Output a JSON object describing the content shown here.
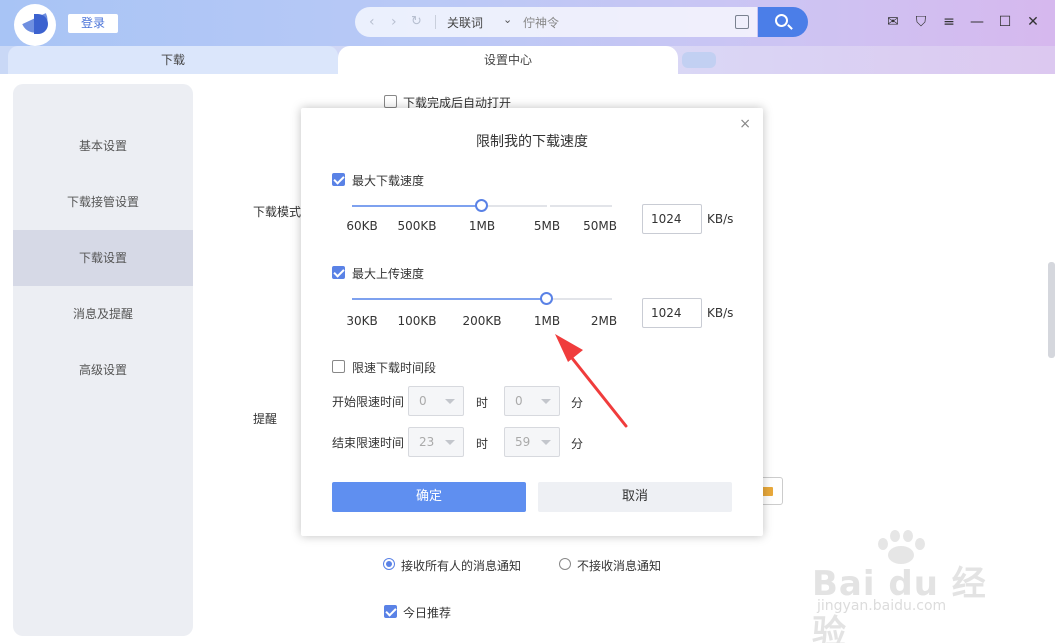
{
  "titlebar": {
    "login_label": "登录",
    "search_keyword": "关联词",
    "search_placeholder": "佇神令"
  },
  "tabs": [
    {
      "label": "下载"
    },
    {
      "label": "设置中心"
    }
  ],
  "sidebar": {
    "items": [
      {
        "label": "基本设置"
      },
      {
        "label": "下载接管设置"
      },
      {
        "label": "下载设置"
      },
      {
        "label": "消息及提醒"
      },
      {
        "label": "高级设置"
      }
    ]
  },
  "background": {
    "auto_open_label": "下载完成后自动打开",
    "download_mode_label": "下载模式",
    "reminder_label": "提醒",
    "receive_all_label": "接收所有人的消息通知",
    "no_receive_label": "不接收消息通知",
    "today_recommend_label": "今日推荐"
  },
  "modal": {
    "title": "限制我的下载速度",
    "close_symbol": "×",
    "max_download": {
      "label": "最大下载速度",
      "ticks": [
        "60KB",
        "500KB",
        "1MB",
        "5MB",
        "50MB"
      ],
      "value": "1024",
      "unit": "KB/s"
    },
    "max_upload": {
      "label": "最大上传速度",
      "ticks": [
        "30KB",
        "100KB",
        "200KB",
        "1MB",
        "2MB"
      ],
      "value": "1024",
      "unit": "KB/s"
    },
    "time_limit_label": "限速下载时间段",
    "start_label": "开始限速时间",
    "end_label": "结束限速时间",
    "start_hour": "0",
    "start_min": "0",
    "end_hour": "23",
    "end_min": "59",
    "hour_unit": "时",
    "min_unit": "分",
    "ok_label": "确定",
    "cancel_label": "取消"
  },
  "watermark": {
    "brand": "Bai du 经验",
    "url": "jingyan.baidu.com"
  },
  "colors": {
    "accent": "#5a82e6",
    "arrow": "#f03c3c"
  }
}
